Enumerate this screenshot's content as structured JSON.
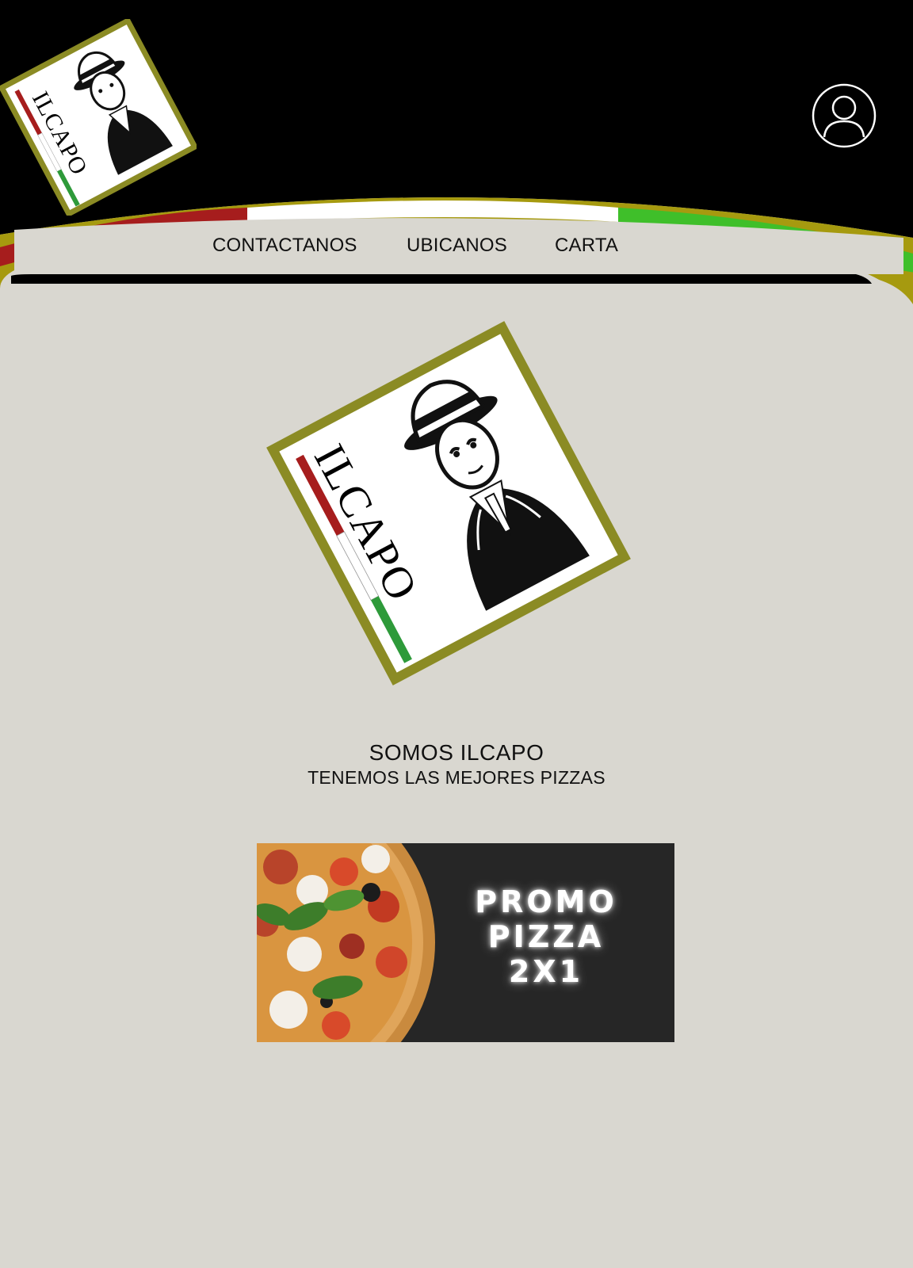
{
  "brand": {
    "name": "ILCAPO",
    "colors": {
      "black": "#000000",
      "gold": "#a69a0f",
      "red": "#a61d1d",
      "white": "#ffffff",
      "green": "#3fbf2a",
      "background": "#d9d7d0"
    }
  },
  "nav": {
    "items": [
      {
        "label": "CONTACTANOS"
      },
      {
        "label": "UBICANOS"
      },
      {
        "label": "CARTA"
      }
    ]
  },
  "user": {
    "icon": "user-icon"
  },
  "hero": {
    "title": "SOMOS ILCAPO",
    "subtitle": "TENEMOS LAS MEJORES PIZZAS"
  },
  "promo": {
    "line1": "PROMO",
    "line2": "PIZZA",
    "line3": "2X1"
  }
}
